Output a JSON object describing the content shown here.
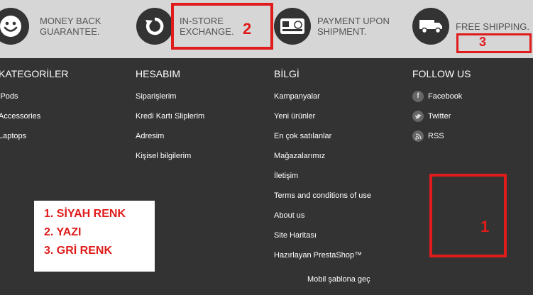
{
  "reassurance": [
    {
      "icon": "smiley-icon",
      "line1": "MONEY BACK",
      "line2": "GUARANTEE."
    },
    {
      "icon": "refresh-icon",
      "line1": "IN-STORE",
      "line2": "EXCHANGE."
    },
    {
      "icon": "card-icon",
      "line1": "PAYMENT UPON",
      "line2": "SHIPMENT."
    },
    {
      "icon": "truck-icon",
      "line1": "FREE SHIPPING.",
      "line2": ""
    }
  ],
  "footer": {
    "categories": {
      "title": "KATEGORİLER",
      "items": [
        "iPods",
        "Accessories",
        "Laptops"
      ]
    },
    "account": {
      "title": "HESABIM",
      "items": [
        "Siparişlerim",
        "Kredi Kartı Sliplerim",
        "Adresim",
        "Kişisel bilgilerim"
      ]
    },
    "info": {
      "title": "BİLGİ",
      "items": [
        "Kampanyalar",
        "Yeni ürünler",
        "En çok satılanlar",
        "Mağazalarımız",
        "İletişim",
        "Terms and conditions of use",
        "About us",
        "Site Haritası",
        "Hazırlayan PrestaShop™"
      ]
    },
    "follow": {
      "title": "FOLLOW US",
      "items": [
        {
          "icon": "facebook-icon",
          "label": "Facebook"
        },
        {
          "icon": "twitter-icon",
          "label": "Twitter"
        },
        {
          "icon": "rss-icon",
          "label": "RSS"
        }
      ]
    },
    "mobile_link": "Mobil şablona geç"
  },
  "annotations": {
    "box1": "1",
    "box2": "2",
    "box3": "3",
    "legend": [
      "1. SİYAH RENK",
      "2. YAZI",
      "3. GRİ RENK"
    ]
  },
  "colors": {
    "footer_bg": "#333333",
    "reassure_bg": "#d6d6d6",
    "annotation_red": "#e01b1b"
  }
}
